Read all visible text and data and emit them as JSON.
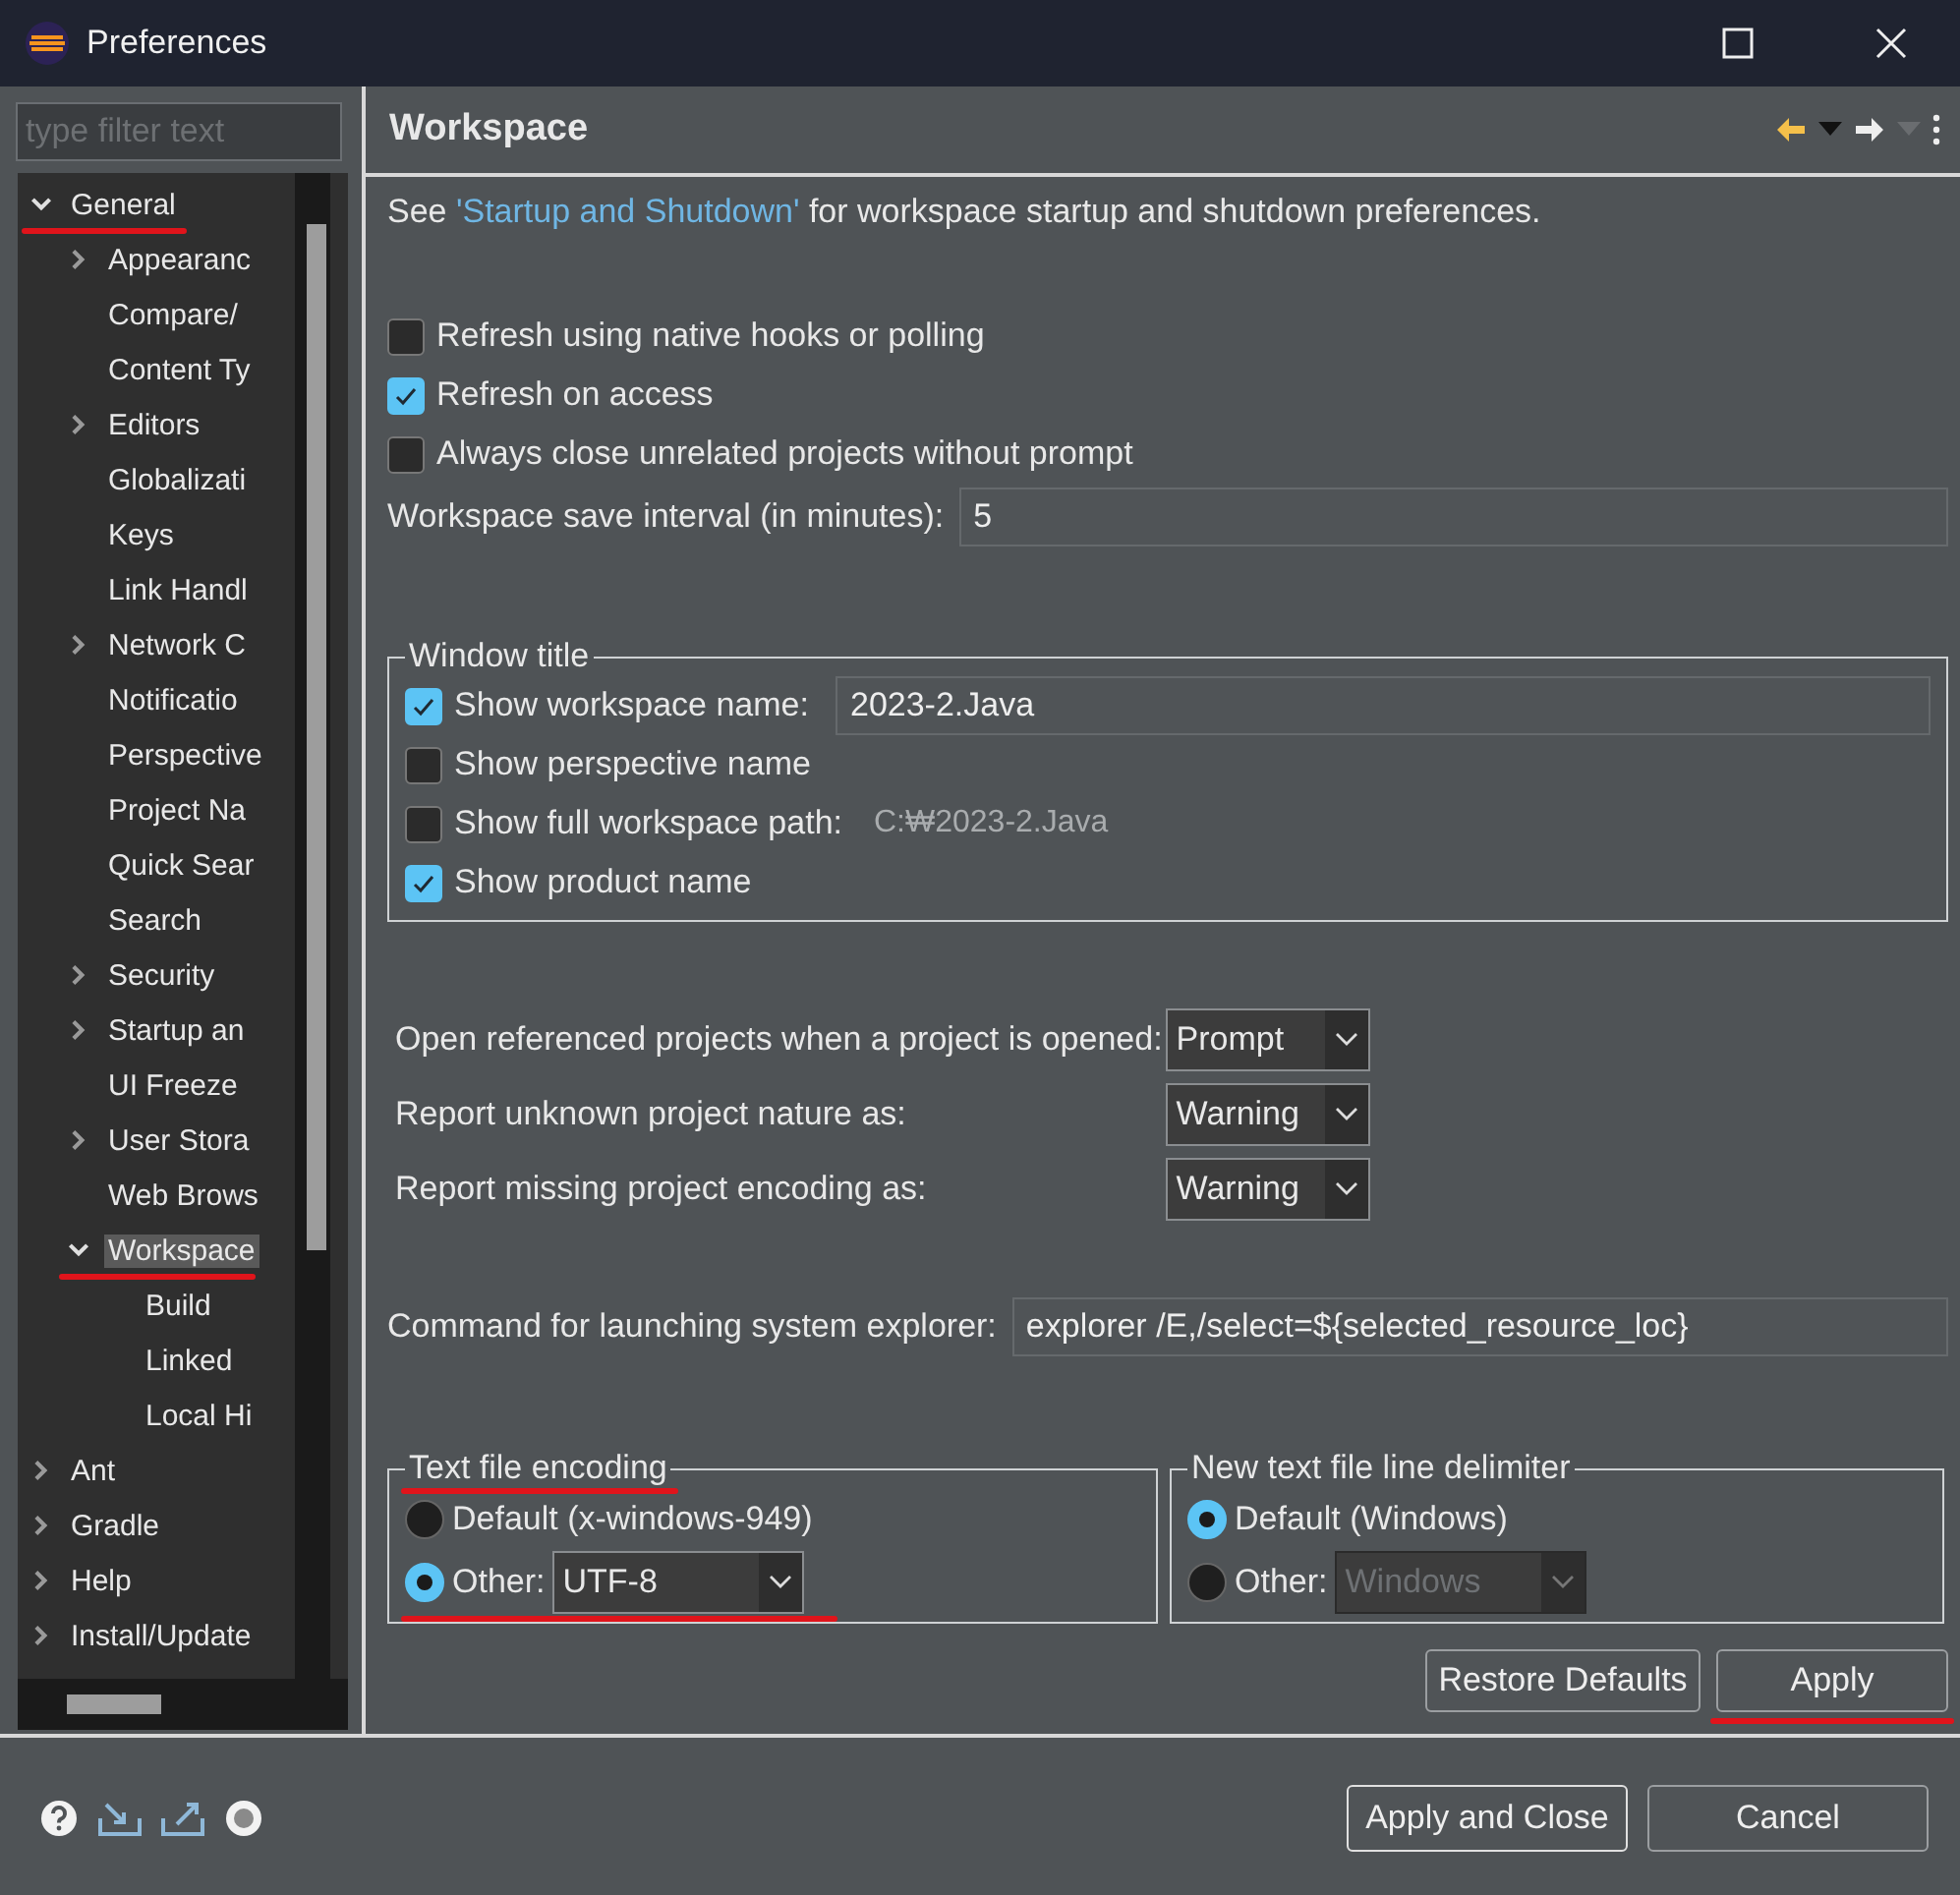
{
  "window": {
    "title": "Preferences"
  },
  "filter": {
    "placeholder": "type filter text"
  },
  "tree": [
    {
      "label": "General",
      "kind": "folder",
      "expanded": true,
      "selected": false,
      "marked": true,
      "children": [
        {
          "label": "Appearanc",
          "kind": "folder",
          "expanded": false,
          "selected": false,
          "marked": false
        },
        {
          "label": "Compare/",
          "kind": "leaf",
          "selected": false,
          "marked": false
        },
        {
          "label": "Content Ty",
          "kind": "leaf",
          "selected": false,
          "marked": false
        },
        {
          "label": "Editors",
          "kind": "folder",
          "expanded": false,
          "selected": false,
          "marked": false
        },
        {
          "label": "Globalizati",
          "kind": "leaf",
          "selected": false,
          "marked": false
        },
        {
          "label": "Keys",
          "kind": "leaf",
          "selected": false,
          "marked": false
        },
        {
          "label": "Link Handl",
          "kind": "leaf",
          "selected": false,
          "marked": false
        },
        {
          "label": "Network C",
          "kind": "folder",
          "expanded": false,
          "selected": false,
          "marked": false
        },
        {
          "label": "Notificatio",
          "kind": "leaf",
          "selected": false,
          "marked": false
        },
        {
          "label": "Perspective",
          "kind": "leaf",
          "selected": false,
          "marked": false
        },
        {
          "label": "Project Na",
          "kind": "leaf",
          "selected": false,
          "marked": false
        },
        {
          "label": "Quick Sear",
          "kind": "leaf",
          "selected": false,
          "marked": false
        },
        {
          "label": "Search",
          "kind": "leaf",
          "selected": false,
          "marked": false
        },
        {
          "label": "Security",
          "kind": "folder",
          "expanded": false,
          "selected": false,
          "marked": false
        },
        {
          "label": "Startup an",
          "kind": "folder",
          "expanded": false,
          "selected": false,
          "marked": false
        },
        {
          "label": "UI Freeze",
          "kind": "leaf",
          "selected": false,
          "marked": false
        },
        {
          "label": "User Stora",
          "kind": "folder",
          "expanded": false,
          "selected": false,
          "marked": false
        },
        {
          "label": "Web Brows",
          "kind": "leaf",
          "selected": false,
          "marked": false
        },
        {
          "label": "Workspace",
          "kind": "folder",
          "expanded": true,
          "selected": true,
          "marked": true,
          "children": [
            {
              "label": "Build",
              "kind": "leaf",
              "selected": false,
              "marked": false
            },
            {
              "label": "Linked",
              "kind": "leaf",
              "selected": false,
              "marked": false
            },
            {
              "label": "Local Hi",
              "kind": "leaf",
              "selected": false,
              "marked": false
            }
          ]
        }
      ]
    },
    {
      "label": "Ant",
      "kind": "folder",
      "expanded": false,
      "selected": false,
      "marked": false
    },
    {
      "label": "Gradle",
      "kind": "folder",
      "expanded": false,
      "selected": false,
      "marked": false
    },
    {
      "label": "Help",
      "kind": "folder",
      "expanded": false,
      "selected": false,
      "marked": false
    },
    {
      "label": "Install/Update",
      "kind": "folder",
      "expanded": false,
      "selected": false,
      "marked": false
    }
  ],
  "page": {
    "title": "Workspace"
  },
  "intro": {
    "before": "See ",
    "link": "'Startup and Shutdown'",
    "after": " for workspace startup and shutdown preferences."
  },
  "options": [
    {
      "label": "Refresh using native hooks or polling",
      "checked": false
    },
    {
      "label": "Refresh on access",
      "checked": true
    },
    {
      "label": "Always close unrelated projects without prompt",
      "checked": false
    }
  ],
  "save_interval": {
    "label": "Workspace save interval (in minutes):",
    "value": "5"
  },
  "window_title_group": {
    "title": "Window title",
    "items": [
      {
        "kind": "field",
        "label": "Show workspace name:",
        "checked": true,
        "value": "2023-2.Java"
      },
      {
        "kind": "plain",
        "label": "Show perspective name",
        "checked": false
      },
      {
        "kind": "hint",
        "label": "Show full workspace path:",
        "checked": false,
        "hint": "C:₩2023-2.Java"
      },
      {
        "kind": "plain",
        "label": "Show product name",
        "checked": true
      }
    ]
  },
  "dropdowns": [
    {
      "label": "Open referenced projects when a project is opened:",
      "value": "Prompt"
    },
    {
      "label": "Report unknown project nature as:",
      "value": "Warning"
    },
    {
      "label": "Report missing project encoding as:",
      "value": "Warning"
    }
  ],
  "explorer_command": {
    "label": "Command for launching system explorer:",
    "value": "explorer /E,/select=${selected_resource_loc}"
  },
  "encoding_group": {
    "title": "Text file encoding",
    "marked": true,
    "options": [
      {
        "label": "Default (x-windows-949)",
        "selected": false,
        "marked": false
      },
      {
        "label": "Other:",
        "selected": true,
        "marked": true,
        "combo": {
          "value": "UTF-8",
          "disabled": false
        }
      }
    ]
  },
  "delimiter_group": {
    "title": "New text file line delimiter",
    "marked": false,
    "options": [
      {
        "label": "Default (Windows)",
        "selected": true,
        "marked": false
      },
      {
        "label": "Other:",
        "selected": false,
        "marked": false,
        "combo": {
          "value": "Windows",
          "disabled": true
        }
      }
    ]
  },
  "page_buttons": [
    {
      "label": "Restore Defaults",
      "marked": false
    },
    {
      "label": "Apply",
      "marked": true
    }
  ],
  "dialog_buttons": [
    {
      "label": "Apply and Close",
      "default": true
    },
    {
      "label": "Cancel",
      "default": false
    }
  ]
}
